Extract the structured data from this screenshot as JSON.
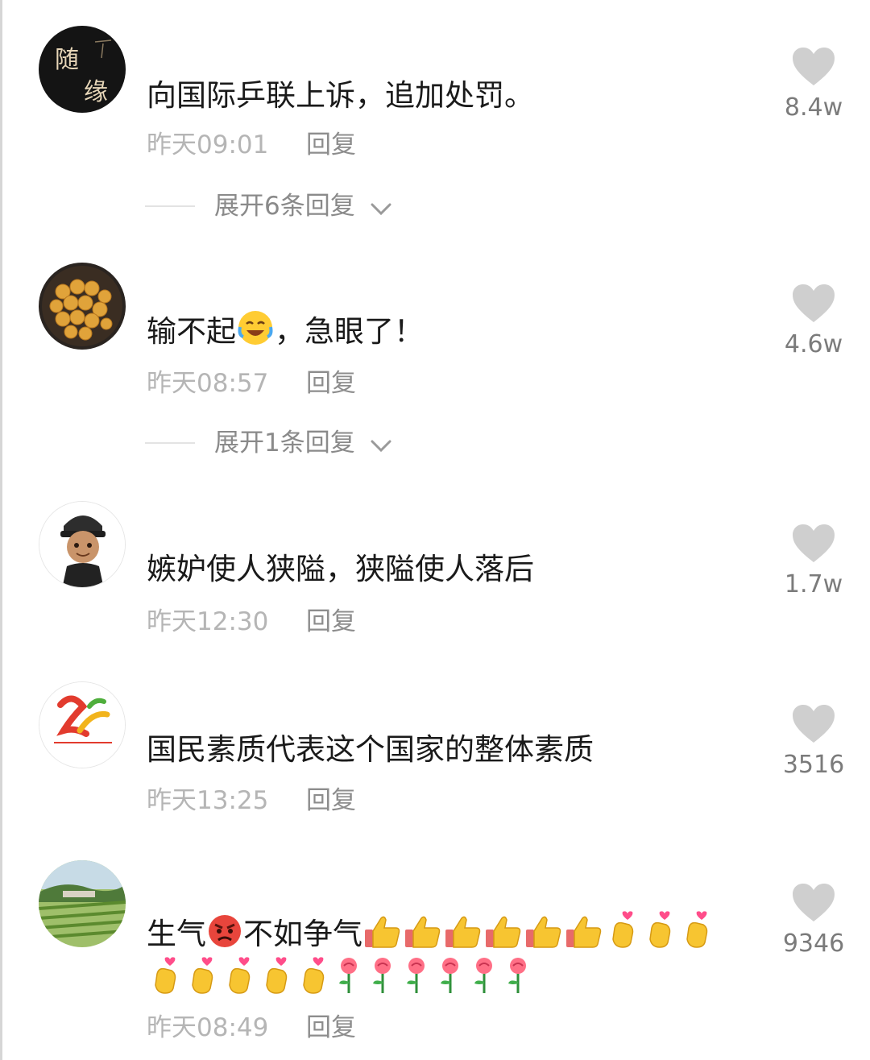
{
  "comments": [
    {
      "text_parts": [
        "向国际乒联上诉，追加处罚。"
      ],
      "time": "昨天09:01",
      "reply_label": "回复",
      "expand_label": "展开6条回复",
      "likes": "8.4w"
    },
    {
      "text_parts": [
        "输不起",
        "，急眼了！"
      ],
      "time": "昨天08:57",
      "reply_label": "回复",
      "expand_label": "展开1条回复",
      "likes": "4.6w",
      "emoji": [
        "crying-laughing-emoji"
      ]
    },
    {
      "text_parts": [
        "嫉妒使人狭隘，狭隘使人落后"
      ],
      "time": "昨天12:30",
      "reply_label": "回复",
      "likes": "1.7w"
    },
    {
      "text_parts": [
        "国民素质代表这个国家的整体素质"
      ],
      "time": "昨天13:25",
      "reply_label": "回复",
      "likes": "3516"
    },
    {
      "text_parts": [
        "生气",
        "不如争气"
      ],
      "time": "昨天08:49",
      "reply_label": "回复",
      "likes": "9346",
      "emoji": [
        "angry-face-emoji",
        "thumbs-up-emoji",
        "finger-heart-emoji",
        "rose-emoji"
      ]
    }
  ],
  "avatar_text": {
    "comment_1": "随缘"
  },
  "colors": {
    "text": "#1a1a1a",
    "meta": "#b5b5b5",
    "reply": "#8d8d8d",
    "heart": "#cfcfcf"
  },
  "icons": [
    "heart-icon",
    "chevron-down-icon"
  ]
}
